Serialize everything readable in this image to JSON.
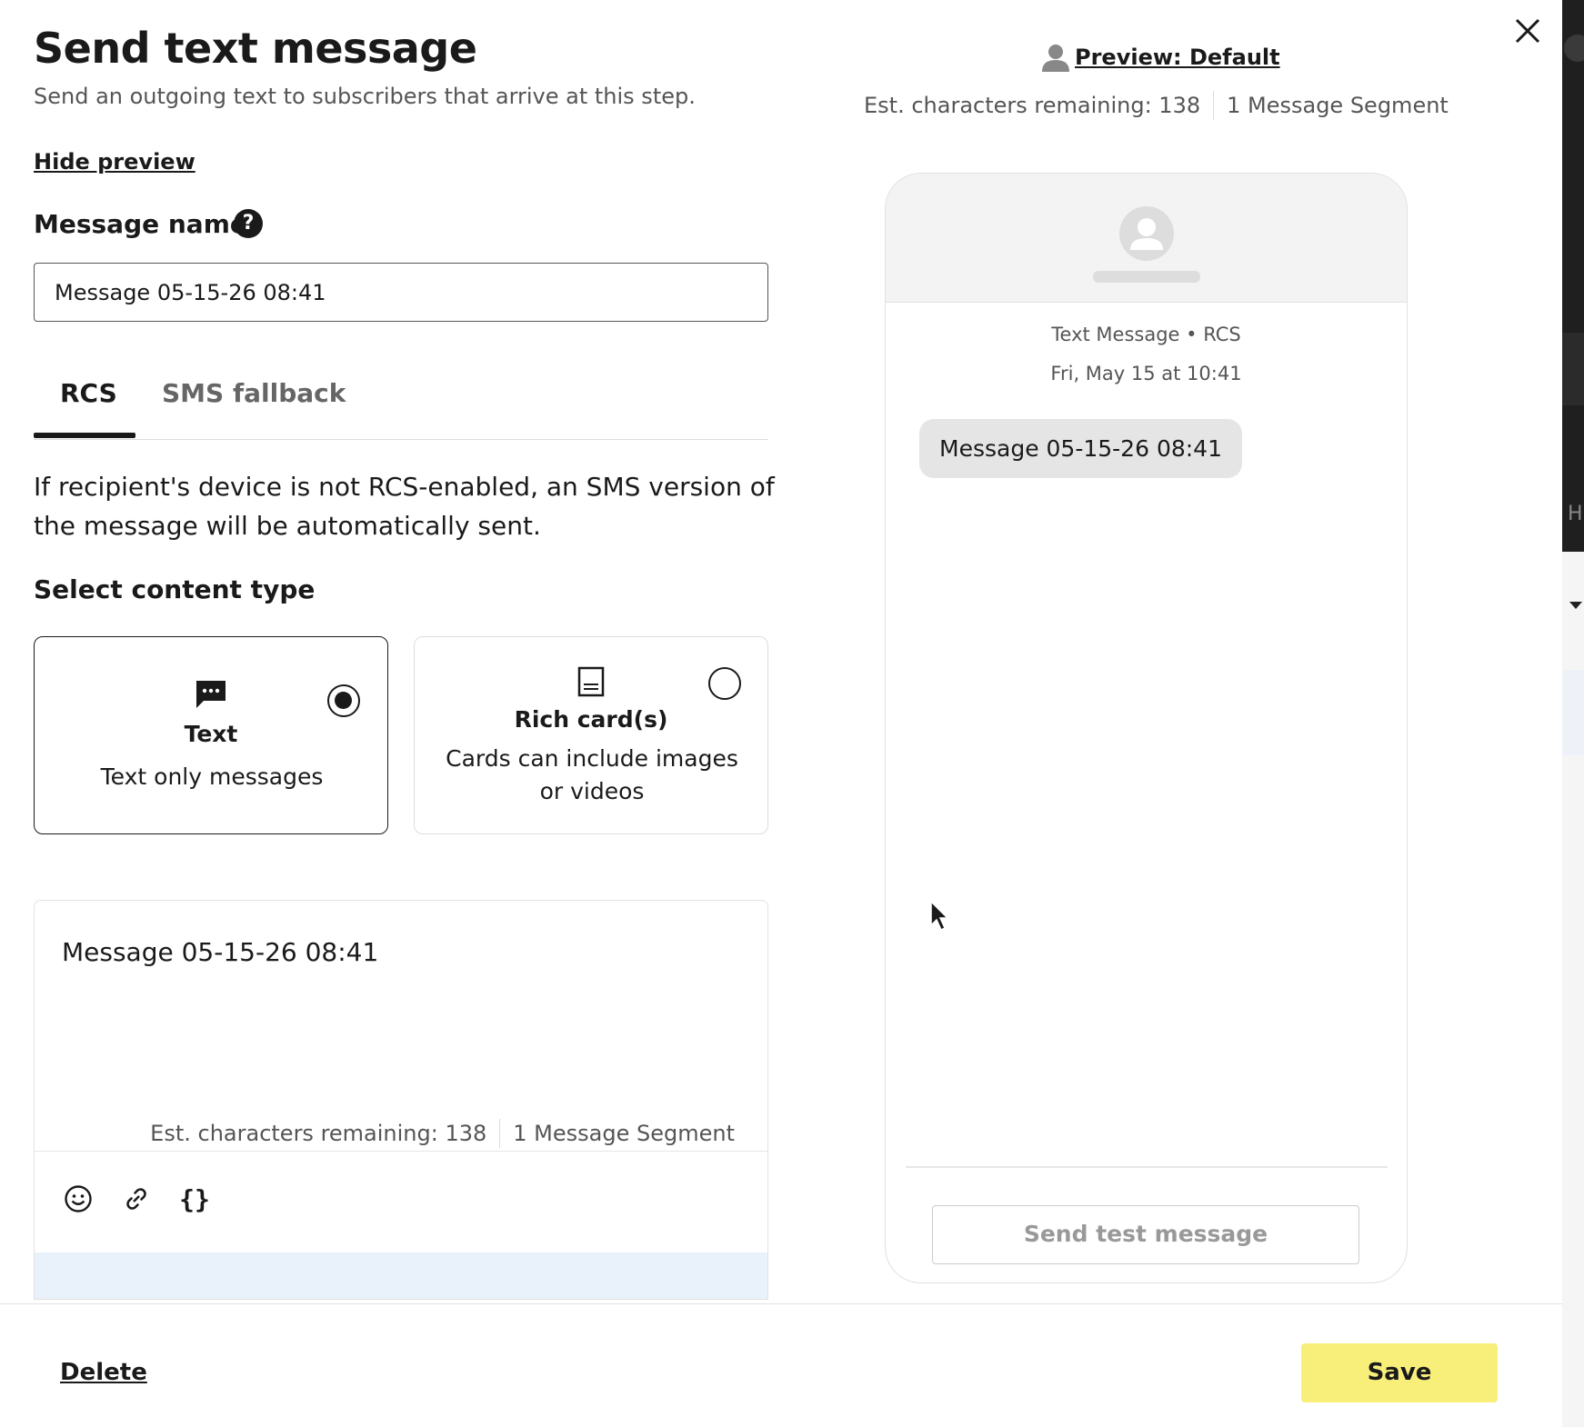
{
  "header": {
    "title": "Send text message",
    "subtitle": "Send an outgoing text to subscribers that arrive at this step.",
    "hide_preview": "Hide preview"
  },
  "message_name": {
    "label": "Message name",
    "help_icon": "question-circle-icon",
    "value": "Message 05-15-26 08:41"
  },
  "tabs": [
    {
      "label": "RCS",
      "active": true
    },
    {
      "label": "SMS fallback",
      "active": false
    }
  ],
  "info_text": "If recipient's device is not RCS-enabled, an SMS version of the message will be automatically sent.",
  "content_type": {
    "label": "Select content type",
    "options": [
      {
        "title": "Text",
        "description": "Text only messages",
        "icon": "chat-bubble-icon",
        "selected": true
      },
      {
        "title": "Rich card(s)",
        "description": "Cards can include images or videos",
        "icon": "card-icon",
        "selected": false
      }
    ]
  },
  "editor": {
    "text": "Message 05-15-26 08:41",
    "chars_remaining": "Est. characters remaining: 138",
    "segments": "1 Message Segment",
    "tools": [
      "emoji-icon",
      "link-icon",
      "braces-icon"
    ]
  },
  "preview": {
    "link_label": "Preview: Default",
    "chars_remaining": "Est. characters remaining: 138",
    "segments": "1 Message Segment",
    "channel": "Text Message • RCS",
    "timestamp": "Fri, May 15 at 10:41",
    "bubble_text": "Message 05-15-26 08:41",
    "test_button": "Send test message"
  },
  "footer": {
    "delete_label": "Delete",
    "save_label": "Save"
  },
  "colors": {
    "save_button": "#f8ef7a",
    "bubble": "#e5e5e5",
    "suggest_bar": "#e9f1fb"
  }
}
